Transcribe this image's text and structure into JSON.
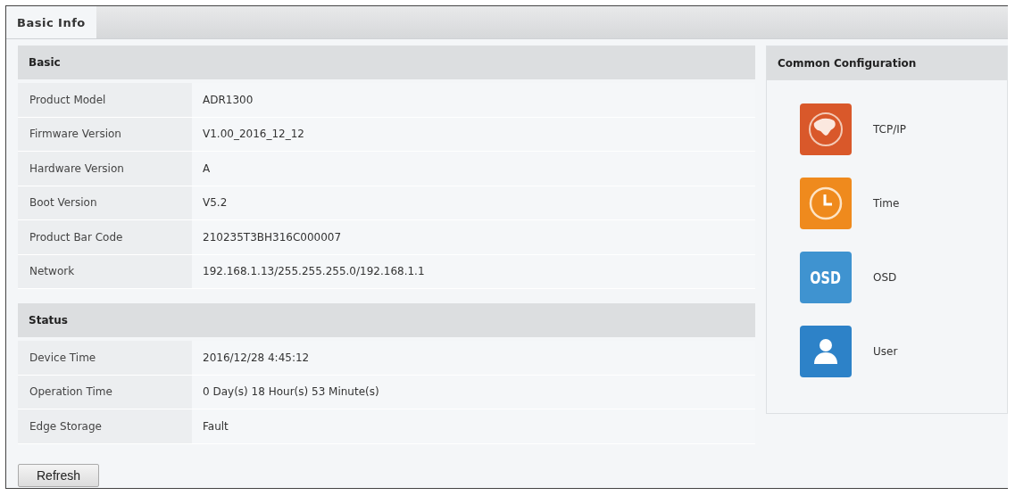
{
  "tabs": [
    {
      "label": "Basic Info",
      "selected": true
    }
  ],
  "sections": [
    {
      "title": "Basic",
      "rows": [
        {
          "label": "Product Model",
          "value": "ADR1300"
        },
        {
          "label": "Firmware Version",
          "value": "V1.00_2016_12_12"
        },
        {
          "label": "Hardware Version",
          "value": "A"
        },
        {
          "label": "Boot Version",
          "value": "V5.2"
        },
        {
          "label": "Product Bar Code",
          "value": "210235T3BH316C000007"
        },
        {
          "label": "Network",
          "value": "192.168.1.13/255.255.255.0/192.168.1.1"
        }
      ]
    },
    {
      "title": "Status",
      "rows": [
        {
          "label": "Device Time",
          "value": "2016/12/28 4:45:12"
        },
        {
          "label": "Operation Time",
          "value": "0 Day(s) 18 Hour(s) 53 Minute(s)"
        },
        {
          "label": "Edge Storage",
          "value": "Fault"
        }
      ]
    }
  ],
  "refresh_button": "Refresh",
  "common_configuration": {
    "title": "Common Configuration",
    "items": [
      {
        "kind": "globe",
        "label": "TCP/IP"
      },
      {
        "kind": "clock",
        "label": "Time"
      },
      {
        "kind": "osd",
        "icon_text": "OSD",
        "label": "OSD"
      },
      {
        "kind": "user",
        "label": "User"
      }
    ]
  }
}
